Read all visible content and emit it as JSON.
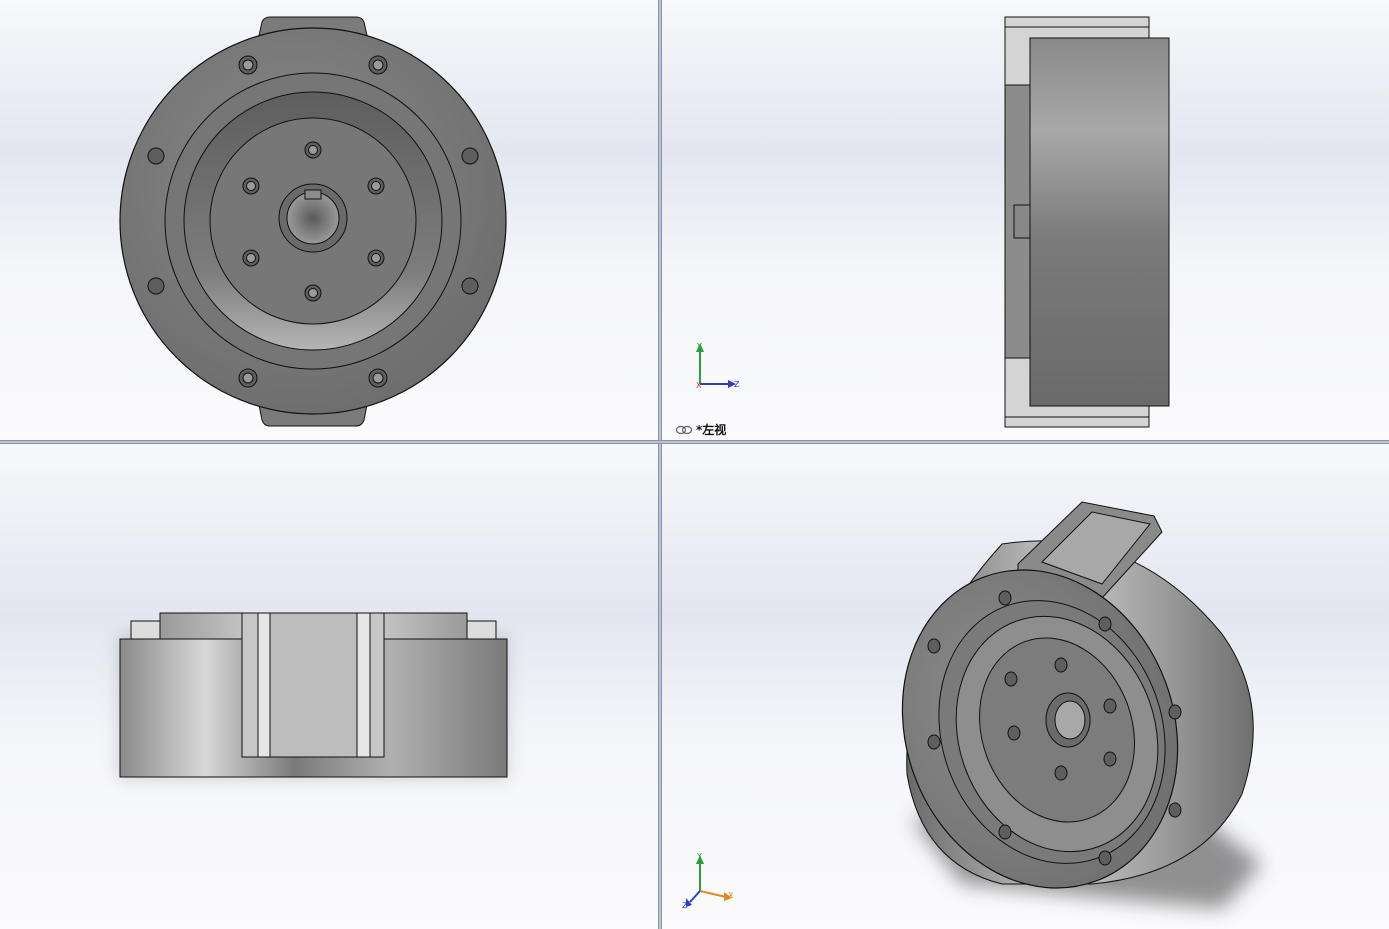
{
  "viewports": {
    "front": {
      "name": "front-view"
    },
    "side": {
      "name": "left-view",
      "label": "*左视"
    },
    "top": {
      "name": "top-view"
    },
    "iso": {
      "name": "isometric-view"
    }
  },
  "triad": {
    "x_label": "X",
    "y_label": "Y",
    "z_label": "Z"
  },
  "colors": {
    "background_top": "#f7f8fb",
    "background_mid": "#e3e6f0",
    "model_gray": "#7a7a7a",
    "model_edge": "#111111",
    "axis_x": "#e0301e",
    "axis_y": "#2e9e3a",
    "axis_z": "#2b3fcf",
    "axis_iso_x": "#e08a1e"
  },
  "icons": {
    "view_link": "link-icon",
    "triad": "coordinate-triad-icon"
  }
}
